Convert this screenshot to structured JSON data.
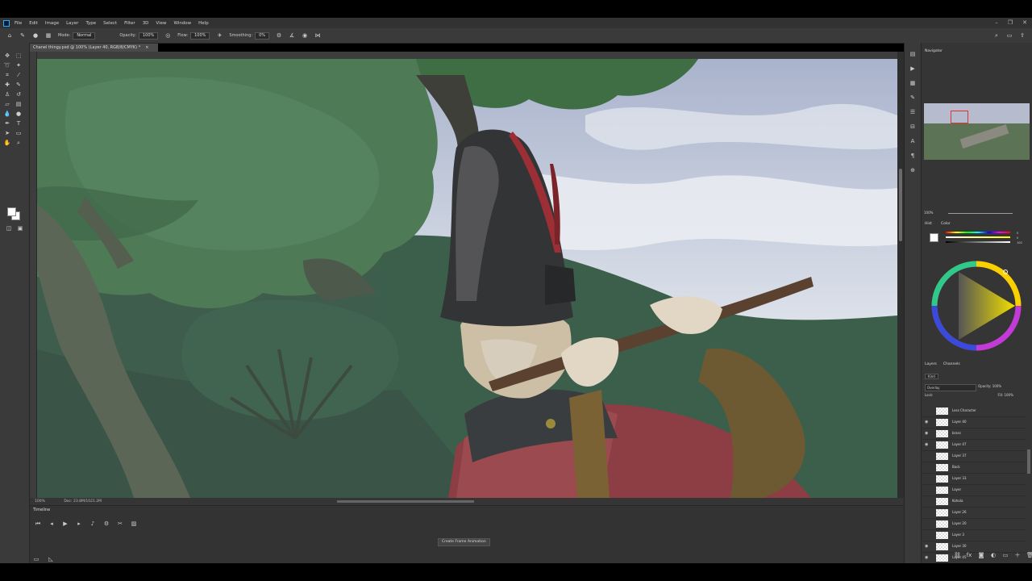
{
  "app": {
    "menu": [
      "File",
      "Edit",
      "Image",
      "Layer",
      "Type",
      "Select",
      "Filter",
      "3D",
      "View",
      "Window",
      "Help"
    ],
    "window_controls": [
      "–",
      "❐",
      "✕"
    ]
  },
  "options_bar": {
    "mode_label": "Mode:",
    "mode_value": "Normal",
    "opacity_label": "Opacity:",
    "opacity_value": "100%",
    "flow_label": "Flow:",
    "flow_value": "100%",
    "smoothing_label": "Smoothing:",
    "smoothing_value": "0%"
  },
  "document": {
    "tab_title": "Chanel thingy.psd @ 100% (Layer 40, RGB/8/CMYK) *",
    "close": "×"
  },
  "status": {
    "zoom": "100%",
    "doc_size": "Doc: 23.8M/1021.2M"
  },
  "timeline": {
    "title": "Timeline",
    "create_button": "Create Frame Animation"
  },
  "panels": {
    "navigator_tab": "Navigator",
    "navigator_zoom": "100%",
    "swatches_tab": "Hist",
    "color_tab": "Color",
    "color_values": [
      "0",
      "0",
      "100"
    ],
    "layers_tab": "Layers",
    "channels_tab": "Channels",
    "filter_kind": "Kind",
    "blend_mode": "Overlay",
    "opacity_label": "Opacity:",
    "opacity_value": "100%",
    "lock_label": "Lock:",
    "fill_label": "Fill:",
    "fill_value": "100%"
  },
  "layers": [
    {
      "name": "Less Character",
      "visible": false
    },
    {
      "name": "Layer 40",
      "visible": true
    },
    {
      "name": "brass",
      "visible": true
    },
    {
      "name": "Layer 47",
      "visible": true
    },
    {
      "name": "Layer 37",
      "visible": false
    },
    {
      "name": "Back",
      "visible": false
    },
    {
      "name": "Layer 33",
      "visible": false
    },
    {
      "name": "Layer",
      "visible": false
    },
    {
      "name": "Kohola",
      "visible": false
    },
    {
      "name": "Layer 26",
      "visible": false
    },
    {
      "name": "Layer 20",
      "visible": false
    },
    {
      "name": "Layer 3",
      "visible": false
    },
    {
      "name": "Layer 30",
      "visible": true
    },
    {
      "name": "Layer 45",
      "visible": true
    }
  ],
  "colors": {
    "ui_dark": "#323232",
    "panel": "#353535",
    "accent_blue": "#31a8ff",
    "nav_red": "#e03333"
  }
}
